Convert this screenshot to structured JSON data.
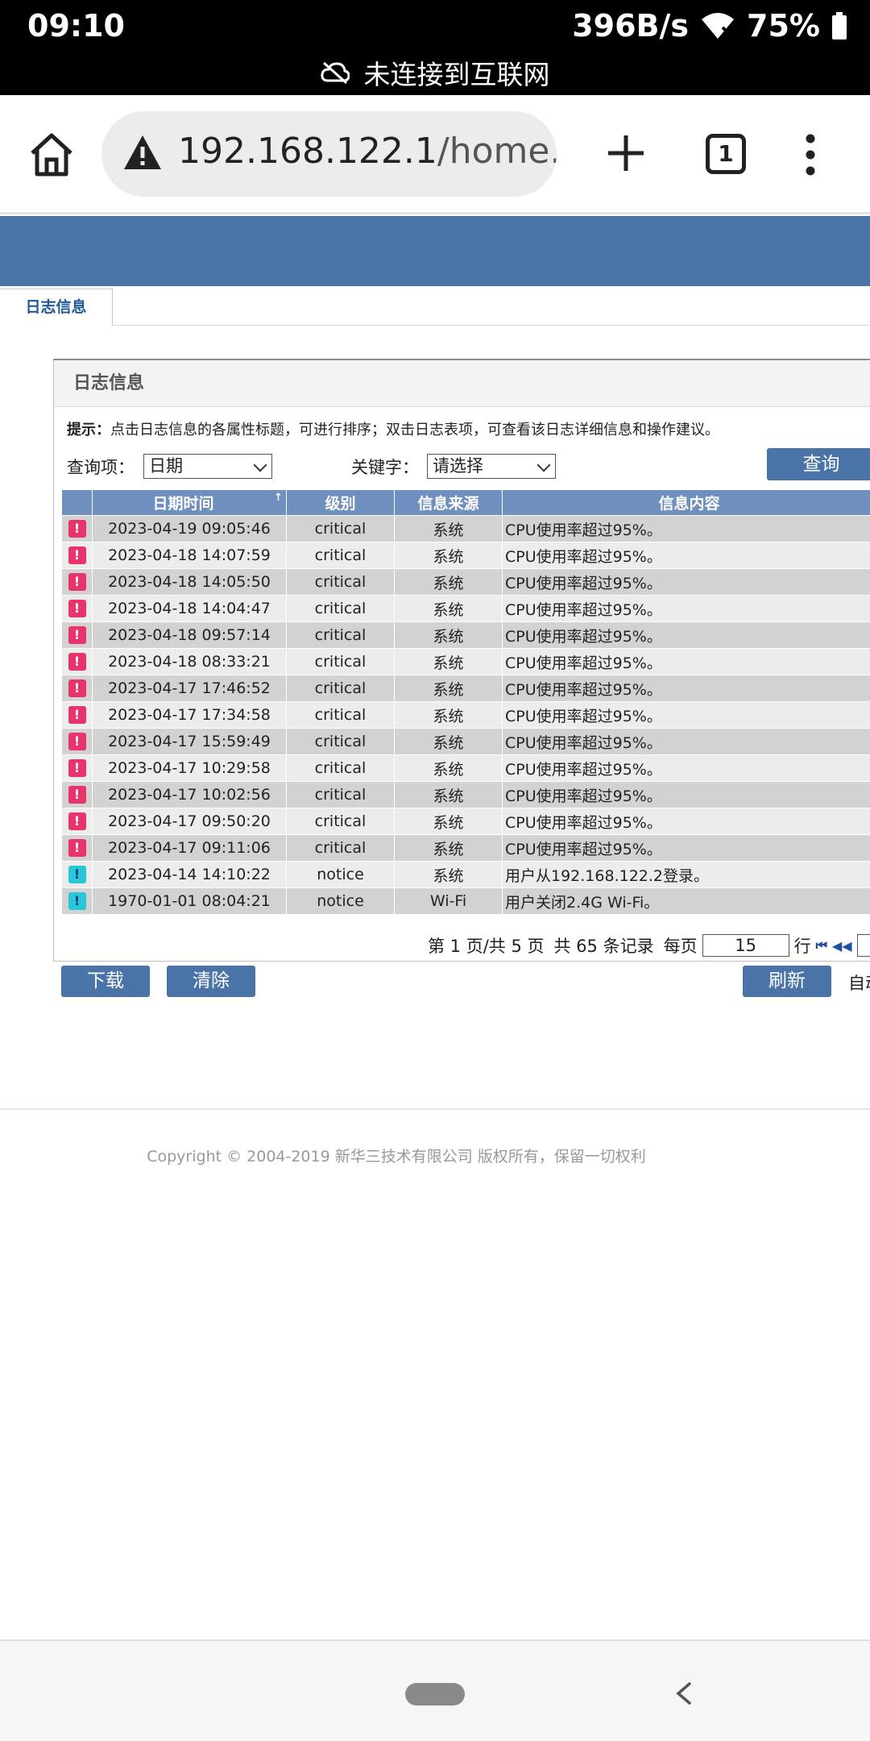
{
  "status_bar": {
    "time": "09:10",
    "net_speed": "396B/s",
    "battery": "75%",
    "offline_notice": "未连接到互联网"
  },
  "browser": {
    "url_host": "192.168.122.1",
    "url_path": "/home.as",
    "tab_count": "1"
  },
  "page": {
    "tab_label": "日志信息",
    "panel_title": "日志信息",
    "hint_label": "提示：",
    "hint_text": "点击日志信息的各属性标题，可进行排序；双击日志表项，可查看该日志详细信息和操作建议。",
    "query": {
      "item_label": "查询项：",
      "item_value": "日期",
      "keyword_label": "关键字：",
      "keyword_value": "请选择",
      "search_button": "查询"
    },
    "table": {
      "headers": [
        "",
        "日期时间",
        "级别",
        "信息来源",
        "信息内容"
      ],
      "sort_indicator": "↑",
      "rows": [
        {
          "level_icon": "critical-icon",
          "datetime": "2023-04-19 09:05:46",
          "level": "critical",
          "source": "系统",
          "content": "CPU使用率超过95%。"
        },
        {
          "level_icon": "critical-icon",
          "datetime": "2023-04-18 14:07:59",
          "level": "critical",
          "source": "系统",
          "content": "CPU使用率超过95%。"
        },
        {
          "level_icon": "critical-icon",
          "datetime": "2023-04-18 14:05:50",
          "level": "critical",
          "source": "系统",
          "content": "CPU使用率超过95%。"
        },
        {
          "level_icon": "critical-icon",
          "datetime": "2023-04-18 14:04:47",
          "level": "critical",
          "source": "系统",
          "content": "CPU使用率超过95%。"
        },
        {
          "level_icon": "critical-icon",
          "datetime": "2023-04-18 09:57:14",
          "level": "critical",
          "source": "系统",
          "content": "CPU使用率超过95%。"
        },
        {
          "level_icon": "critical-icon",
          "datetime": "2023-04-18 08:33:21",
          "level": "critical",
          "source": "系统",
          "content": "CPU使用率超过95%。"
        },
        {
          "level_icon": "critical-icon",
          "datetime": "2023-04-17 17:46:52",
          "level": "critical",
          "source": "系统",
          "content": "CPU使用率超过95%。"
        },
        {
          "level_icon": "critical-icon",
          "datetime": "2023-04-17 17:34:58",
          "level": "critical",
          "source": "系统",
          "content": "CPU使用率超过95%。"
        },
        {
          "level_icon": "critical-icon",
          "datetime": "2023-04-17 15:59:49",
          "level": "critical",
          "source": "系统",
          "content": "CPU使用率超过95%。"
        },
        {
          "level_icon": "critical-icon",
          "datetime": "2023-04-17 10:29:58",
          "level": "critical",
          "source": "系统",
          "content": "CPU使用率超过95%。"
        },
        {
          "level_icon": "critical-icon",
          "datetime": "2023-04-17 10:02:56",
          "level": "critical",
          "source": "系统",
          "content": "CPU使用率超过95%。"
        },
        {
          "level_icon": "critical-icon",
          "datetime": "2023-04-17 09:50:20",
          "level": "critical",
          "source": "系统",
          "content": "CPU使用率超过95%。"
        },
        {
          "level_icon": "critical-icon",
          "datetime": "2023-04-17 09:11:06",
          "level": "critical",
          "source": "系统",
          "content": "CPU使用率超过95%。"
        },
        {
          "level_icon": "notice-icon",
          "datetime": "2023-04-14 14:10:22",
          "level": "notice",
          "source": "系统",
          "content": "用户从192.168.122.2登录。"
        },
        {
          "level_icon": "notice-icon",
          "datetime": "1970-01-01 08:04:21",
          "level": "notice",
          "source": "Wi-Fi",
          "content": "用户关闭2.4G Wi-Fi。"
        }
      ]
    },
    "pager": {
      "page_info": "第 1 页/共 5 页",
      "total_info": "共 65 条记录",
      "per_page_label": "每页",
      "per_page_value": "15",
      "rows_unit": "行"
    },
    "actions": {
      "download": "下载",
      "clear": "清除",
      "refresh": "刷新",
      "auto_refresh_partial": "自动"
    },
    "copyright": "Copyright © 2004-2019 新华三技术有限公司 版权所有，保留一切权利"
  },
  "colors": {
    "brand_blue": "#4a74a8",
    "table_header": "#6f8fbf",
    "critical": "#e8336b",
    "notice": "#27c7d8"
  }
}
